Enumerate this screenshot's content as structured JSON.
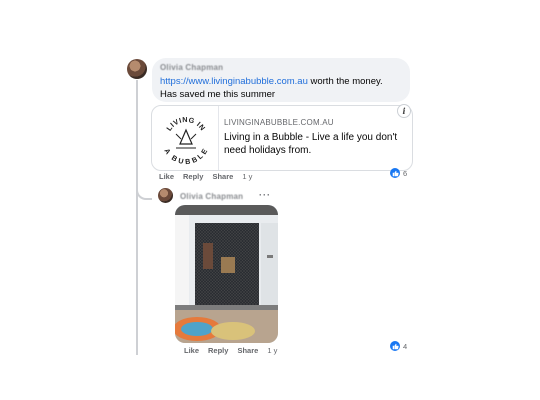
{
  "comment1": {
    "author": "Olivia Chapman",
    "link_text": "https://www.livinginabubble.com.au",
    "text_after_link": " worth the money.",
    "text_line2": "Has saved me this summer",
    "preview": {
      "logo_top": "LIVING IN",
      "logo_bottom": "A BUBBLE",
      "domain": "LIVINGINABUBBLE.COM.AU",
      "title": "Living in a Bubble - Live a life you don't need holidays from."
    },
    "actions": {
      "like": "Like",
      "reply": "Reply",
      "share": "Share",
      "time": "1 y"
    },
    "reaction_count": "6",
    "info_icon": "i"
  },
  "reply1": {
    "author": "Olivia Chapman",
    "more_icon": "···",
    "actions": {
      "like": "Like",
      "reply": "Reply",
      "share": "Share",
      "time": "1 y"
    },
    "reaction_count": "4"
  },
  "colors": {
    "link": "#216fdb",
    "reaction": "#1877f2",
    "bubble": "#f0f2f5"
  },
  "icons": [
    "info-icon",
    "thumbs-up-icon",
    "more-options-icon",
    "avatar"
  ]
}
